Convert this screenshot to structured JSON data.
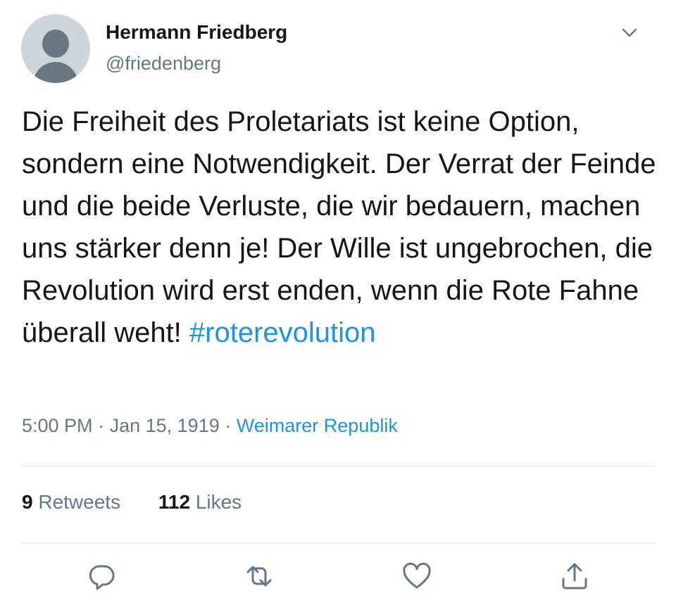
{
  "user": {
    "name": "Hermann Friedberg",
    "handle": "@friedenberg"
  },
  "tweet": {
    "text": "Die Freiheit des Proletariats ist keine Option, sondern eine Notwendigkeit. Der Verrat der Feinde und die beide Verluste, die wir bedauern, machen uns stärker denn je! Der Wille ist ungebrochen, die Revolution wird erst enden, wenn die Rote Fahne überall weht!",
    "hashtag": "#roterevolution"
  },
  "meta": {
    "time": "5:00 PM",
    "sep1": "·",
    "date": "Jan 15, 1919",
    "sep2": "·",
    "source": "Weimarer Republik"
  },
  "stats": {
    "retweets_count": "9",
    "retweets_label": "Retweets",
    "likes_count": "112",
    "likes_label": "Likes"
  },
  "icons": {
    "caret": "chevron-down-icon",
    "reply": "reply-icon",
    "retweet": "retweet-icon",
    "like": "heart-icon",
    "share": "share-icon"
  },
  "colors": {
    "link": "#1b95e0",
    "secondary_text": "#657786",
    "primary_text": "#14171a",
    "divider": "#e1e8ed",
    "avatar_bg": "#ccd6dd",
    "avatar_fg": "#697783"
  }
}
